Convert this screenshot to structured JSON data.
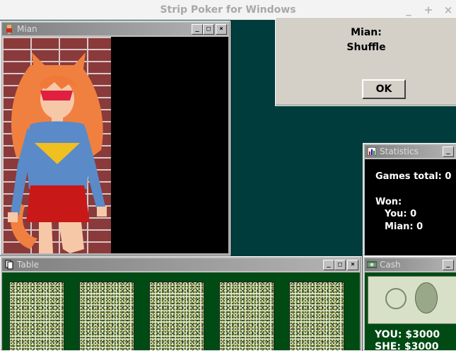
{
  "app": {
    "title": "Strip Poker for Windows",
    "controls": [
      "_",
      "+",
      "×"
    ]
  },
  "mian_window": {
    "title": "Mian"
  },
  "message_box": {
    "speaker": "Mian:",
    "message": "Shuffle",
    "ok_label": "OK"
  },
  "statistics": {
    "title": "Statistics",
    "games_total": "Games total: 0",
    "won_label": "Won:",
    "you": "You: 0",
    "mian": "Mian: 0"
  },
  "table": {
    "title": "Table",
    "cards": [
      "card-back",
      "card-back",
      "card-back",
      "card-back",
      "card-back"
    ]
  },
  "cash": {
    "title": "Cash",
    "you": "YOU: $3000",
    "she": "SHE: $3000"
  },
  "colors": {
    "desktop": "#003c3c",
    "felt": "#004a14",
    "titlebar_gradient_start": "#808080"
  }
}
